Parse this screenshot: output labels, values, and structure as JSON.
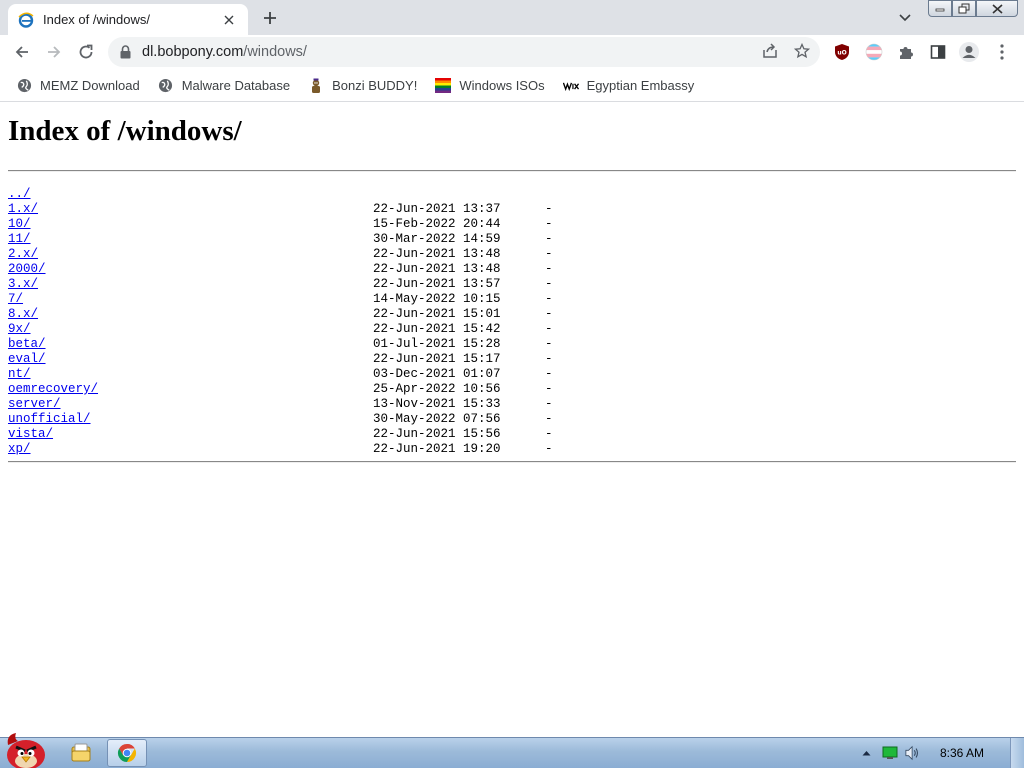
{
  "browser": {
    "tab": {
      "title": "Index of /windows/",
      "favicon": "ie-icon"
    },
    "url": {
      "host": "dl.bobpony.com",
      "path": "/windows/"
    },
    "window_controls": [
      "minimize",
      "maximize",
      "close"
    ],
    "extensions": [
      "ublock-origin-icon",
      "trans-flag-extension-icon",
      "puzzle-extensions-icon",
      "side-panel-icon",
      "profile-icon",
      "menu-icon"
    ]
  },
  "bookmarks": [
    {
      "label": "MEMZ Download",
      "icon": "globe-icon"
    },
    {
      "label": "Malware Database",
      "icon": "globe-icon"
    },
    {
      "label": "Bonzi BUDDY!",
      "icon": "bonzi-icon"
    },
    {
      "label": "Windows ISOs",
      "icon": "rainbow-flag-icon"
    },
    {
      "label": "Egyptian Embassy",
      "icon": "wix-icon"
    }
  ],
  "page": {
    "title": "Index of /windows/",
    "entries": [
      {
        "name": "../",
        "date": "",
        "size": ""
      },
      {
        "name": "1.x/",
        "date": "22-Jun-2021 13:37",
        "size": "-"
      },
      {
        "name": "10/",
        "date": "15-Feb-2022 20:44",
        "size": "-"
      },
      {
        "name": "11/",
        "date": "30-Mar-2022 14:59",
        "size": "-"
      },
      {
        "name": "2.x/",
        "date": "22-Jun-2021 13:48",
        "size": "-"
      },
      {
        "name": "2000/",
        "date": "22-Jun-2021 13:48",
        "size": "-"
      },
      {
        "name": "3.x/",
        "date": "22-Jun-2021 13:57",
        "size": "-"
      },
      {
        "name": "7/",
        "date": "14-May-2022 10:15",
        "size": "-"
      },
      {
        "name": "8.x/",
        "date": "22-Jun-2021 15:01",
        "size": "-"
      },
      {
        "name": "9x/",
        "date": "22-Jun-2021 15:42",
        "size": "-"
      },
      {
        "name": "beta/",
        "date": "01-Jul-2021 15:28",
        "size": "-"
      },
      {
        "name": "eval/",
        "date": "22-Jun-2021 15:17",
        "size": "-"
      },
      {
        "name": "nt/",
        "date": "03-Dec-2021 01:07",
        "size": "-"
      },
      {
        "name": "oemrecovery/",
        "date": "25-Apr-2022 10:56",
        "size": "-"
      },
      {
        "name": "server/",
        "date": "13-Nov-2021 15:33",
        "size": "-"
      },
      {
        "name": "unofficial/",
        "date": "30-May-2022 07:56",
        "size": "-"
      },
      {
        "name": "vista/",
        "date": "22-Jun-2021 15:56",
        "size": "-"
      },
      {
        "name": "xp/",
        "date": "22-Jun-2021 19:20",
        "size": "-"
      }
    ]
  },
  "taskbar": {
    "start": "angry-bird-start-icon",
    "pinned": [
      "explorer-icon",
      "chrome-icon"
    ],
    "tray": [
      "show-hidden-icons-arrow",
      "network-icon",
      "volume-icon"
    ],
    "clock": "8:36 AM"
  },
  "colors": {
    "link": "#0000ee",
    "tabstrip": "#dee1e6",
    "omnibox": "#f1f3f4",
    "taskbar": "#9cbad9"
  }
}
